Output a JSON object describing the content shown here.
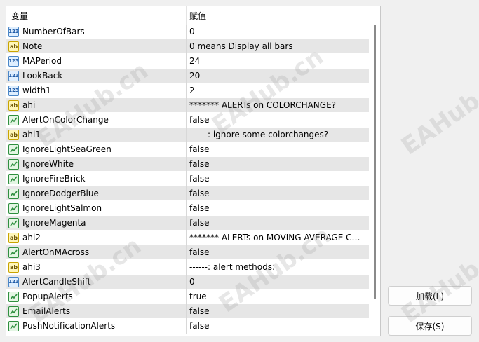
{
  "columns": {
    "name": "变量",
    "value": "赋值"
  },
  "rows": [
    {
      "type": "num",
      "name": "NumberOfBars",
      "value": "0"
    },
    {
      "type": "str",
      "name": "Note",
      "value": "0 means Display all bars"
    },
    {
      "type": "num",
      "name": "MAPeriod",
      "value": "24"
    },
    {
      "type": "num",
      "name": "LookBack",
      "value": "20"
    },
    {
      "type": "num",
      "name": "width1",
      "value": "2"
    },
    {
      "type": "str",
      "name": "ahi",
      "value": "******* ALERTs on COLORCHANGE?"
    },
    {
      "type": "bool",
      "name": "AlertOnColorChange",
      "value": "false"
    },
    {
      "type": "str",
      "name": "ahi1",
      "value": "------: ignore some colorchanges?"
    },
    {
      "type": "bool",
      "name": "IgnoreLightSeaGreen",
      "value": "false"
    },
    {
      "type": "bool",
      "name": "IgnoreWhite",
      "value": "false"
    },
    {
      "type": "bool",
      "name": "IgnoreFireBrick",
      "value": "false"
    },
    {
      "type": "bool",
      "name": "IgnoreDodgerBlue",
      "value": "false"
    },
    {
      "type": "bool",
      "name": "IgnoreLightSalmon",
      "value": "false"
    },
    {
      "type": "bool",
      "name": "IgnoreMagenta",
      "value": "false"
    },
    {
      "type": "str",
      "name": "ahi2",
      "value": "******* ALERTs on MOVING AVERAGE CR..."
    },
    {
      "type": "bool",
      "name": "AlertOnMAcross",
      "value": "false"
    },
    {
      "type": "str",
      "name": "ahi3",
      "value": "------: alert methods:"
    },
    {
      "type": "num",
      "name": "AlertCandleShift",
      "value": "0"
    },
    {
      "type": "bool",
      "name": "PopupAlerts",
      "value": "true"
    },
    {
      "type": "bool",
      "name": "EmailAlerts",
      "value": "false"
    },
    {
      "type": "bool",
      "name": "PushNotificationAlerts",
      "value": "false"
    }
  ],
  "icons": {
    "num": "123",
    "str": "ab",
    "bool": "bool-check-icon"
  },
  "buttons": {
    "load": "加载(L)",
    "save": "保存(S)"
  },
  "watermark": "EAHub.cn"
}
